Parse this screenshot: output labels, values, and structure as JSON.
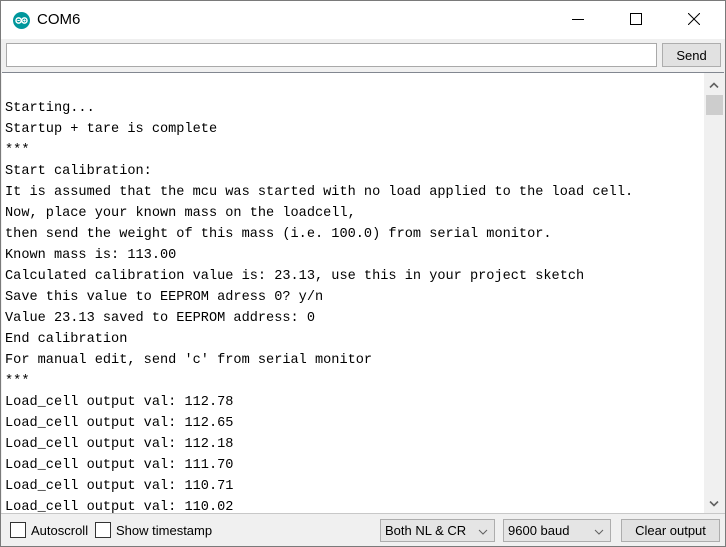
{
  "window": {
    "title": "COM6",
    "app_icon": "arduino-icon",
    "controls": [
      "minimize-icon",
      "maximize-icon",
      "close-icon"
    ]
  },
  "send_row": {
    "input_value": "",
    "input_placeholder": "",
    "send_label": "Send"
  },
  "output": {
    "lines": [
      "Starting...",
      "Startup + tare is complete",
      "***",
      "Start calibration:",
      "It is assumed that the mcu was started with no load applied to the load cell.",
      "Now, place your known mass on the loadcell,",
      "then send the weight of this mass (i.e. 100.0) from serial monitor.",
      "Known mass is: 113.00",
      "Calculated calibration value is: 23.13, use this in your project sketch",
      "Save this value to EEPROM adress 0? y/n",
      "Value 23.13 saved to EEPROM address: 0",
      "End calibration",
      "For manual edit, send 'c' from serial monitor",
      "***",
      "Load_cell output val: 112.78",
      "Load_cell output val: 112.65",
      "Load_cell output val: 112.18",
      "Load_cell output val: 111.70",
      "Load_cell output val: 110.71",
      "Load_cell output val: 110.02"
    ]
  },
  "bottom_bar": {
    "autoscroll_label": "Autoscroll",
    "autoscroll_checked": false,
    "timestamp_label": "Show timestamp",
    "timestamp_checked": false,
    "line_ending_selected": "Both NL & CR",
    "baud_selected": "9600 baud",
    "clear_label": "Clear output"
  },
  "colors": {
    "accent": "#00979c"
  }
}
